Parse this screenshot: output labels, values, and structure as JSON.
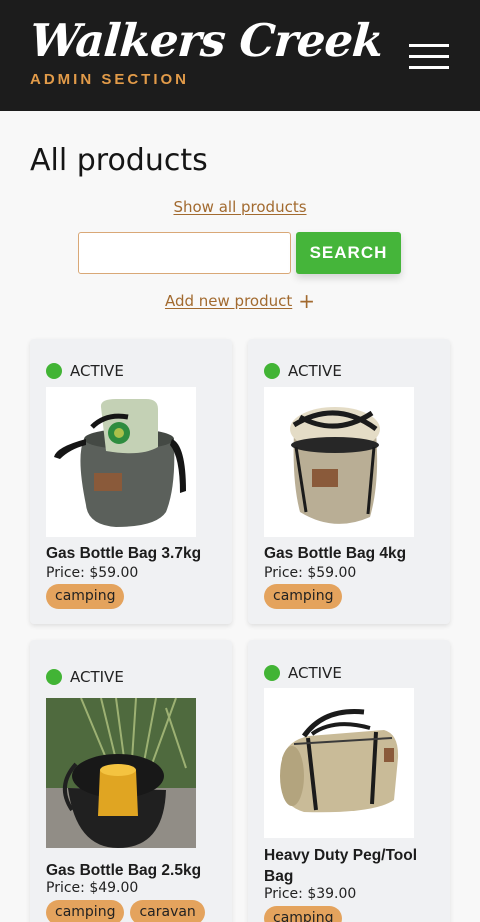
{
  "header": {
    "logo": "Walkers Creek",
    "subtitle": "ADMIN SECTION"
  },
  "page": {
    "title": "All products",
    "show_all_link": "Show all products",
    "search_placeholder": "",
    "search_value": "",
    "search_button": "SEARCH",
    "add_link": "Add new product",
    "add_icon": "+"
  },
  "products": [
    {
      "status": "ACTIVE",
      "name": "Gas Bottle Bag 3.7kg",
      "price_label": "Price:",
      "price": "$59.00",
      "tags": [
        "camping"
      ],
      "image": "gas-bottle-bag-green"
    },
    {
      "status": "ACTIVE",
      "name": "Gas Bottle Bag 4kg",
      "price_label": "Price:",
      "price": "$59.00",
      "tags": [
        "camping"
      ],
      "image": "gas-bottle-bag-canvas"
    },
    {
      "status": "ACTIVE",
      "name": "Gas Bottle Bag 2.5kg",
      "price_label": "Price:",
      "price": "$49.00",
      "tags": [
        "camping",
        "caravan"
      ],
      "image": "gas-bottle-bag-outdoor"
    },
    {
      "status": "ACTIVE",
      "name": "Heavy Duty Peg/Tool Bag",
      "price_label": "Price:",
      "price": "$39.00",
      "tags": [
        "camping"
      ],
      "image": "peg-tool-bag"
    }
  ],
  "colors": {
    "header_bg": "#1c1c1c",
    "accent": "#e29b49",
    "active_dot": "#42b435",
    "search_button": "#45b53a",
    "tag": "#e4a35d"
  }
}
